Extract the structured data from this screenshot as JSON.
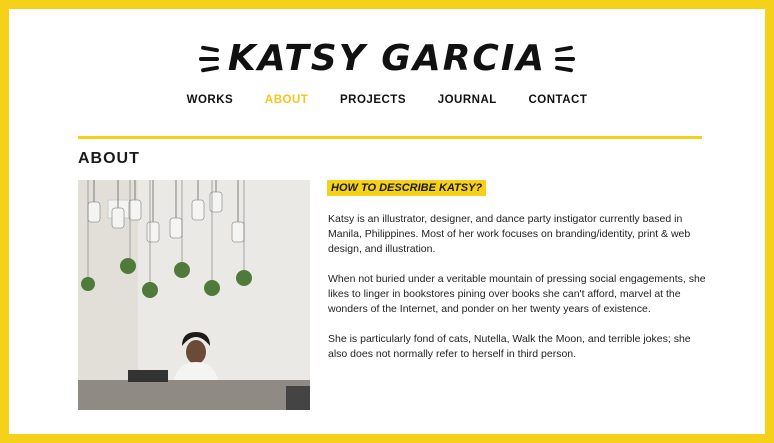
{
  "site": {
    "logo_text": "KATSY GARCIA"
  },
  "nav": {
    "items": [
      {
        "label": "WORKS"
      },
      {
        "label": "ABOUT",
        "active": true
      },
      {
        "label": "PROJECTS"
      },
      {
        "label": "JOURNAL"
      },
      {
        "label": "CONTACT"
      }
    ]
  },
  "page": {
    "section_title": "ABOUT",
    "subheading": "HOW TO DESCRIBE KATSY?",
    "paragraphs": [
      "Katsy is an illustrator, designer, and dance party instigator currently based in Manila, Philippines. Most of her work focuses on branding/identity, print & web design, and illustration.",
      "When not buried under a veritable mountain of pressing social engagements, she likes to linger in bookstores pining over books she can't afford, marvel at the wonders of the Internet, and ponder on her twenty years of existence.",
      "She is particularly fond of cats, Nutella, Walk the Moon, and terrible jokes; she also does not normally refer to herself in third person."
    ]
  },
  "colors": {
    "accent": "#f5d11a",
    "nav_active": "#f5c518",
    "text": "#1a1a1a"
  }
}
